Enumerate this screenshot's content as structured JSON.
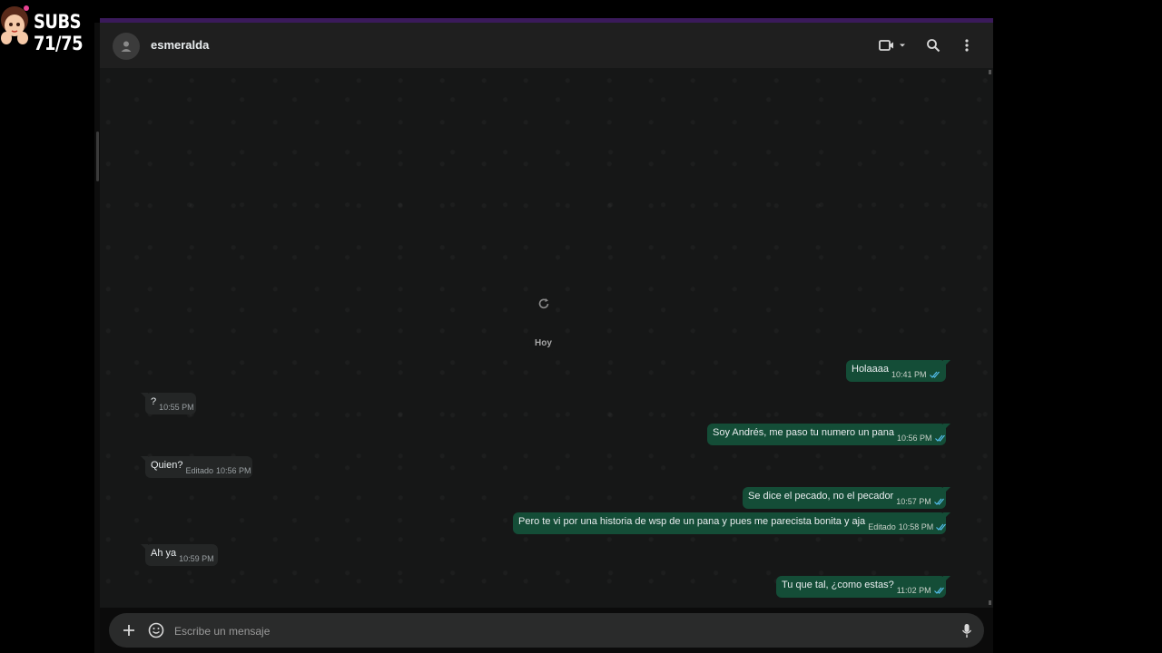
{
  "overlay": {
    "subs_label": "SUBS 71/75"
  },
  "header": {
    "contact_name": "esmeralda"
  },
  "chat": {
    "date_label": "Hoy",
    "messages": [
      {
        "dir": "out",
        "text": "Holaaaa",
        "edited": "",
        "time": "10:41 PM",
        "read": true
      },
      {
        "dir": "in",
        "text": "?",
        "edited": "",
        "time": "10:55 PM"
      },
      {
        "dir": "out",
        "text": "Soy Andrés, me paso tu numero un pana",
        "edited": "",
        "time": "10:56 PM",
        "read": true
      },
      {
        "dir": "in",
        "text": "Quien?",
        "edited": "Editado",
        "time": "10:56 PM"
      },
      {
        "dir": "out",
        "text": "Se dice el pecado, no el pecador",
        "edited": "",
        "time": "10:57 PM",
        "read": true
      },
      {
        "dir": "out",
        "text": "Pero te vi por una historia de wsp de un pana y pues me parecista bonita y aja",
        "edited": "Editado",
        "time": "10:58 PM",
        "read": true
      },
      {
        "dir": "in",
        "text": "Ah ya",
        "edited": "",
        "time": "10:59 PM"
      },
      {
        "dir": "out",
        "text": "Tu que tal, ¿como estas?",
        "edited": "",
        "time": "11:02 PM",
        "read": true
      }
    ]
  },
  "composer": {
    "placeholder": "Escribe un mensaje"
  },
  "colors": {
    "outgoing_bubble": "#144d37",
    "incoming_bubble": "#242626",
    "read_tick": "#53bdeb",
    "header_bg": "#1f1f1f"
  },
  "icons": [
    "person-icon",
    "video-call-icon",
    "chevron-down-icon",
    "search-icon",
    "more-vert-icon",
    "refresh-icon",
    "plus-icon",
    "emoji-icon",
    "mic-icon",
    "double-check-icon"
  ]
}
